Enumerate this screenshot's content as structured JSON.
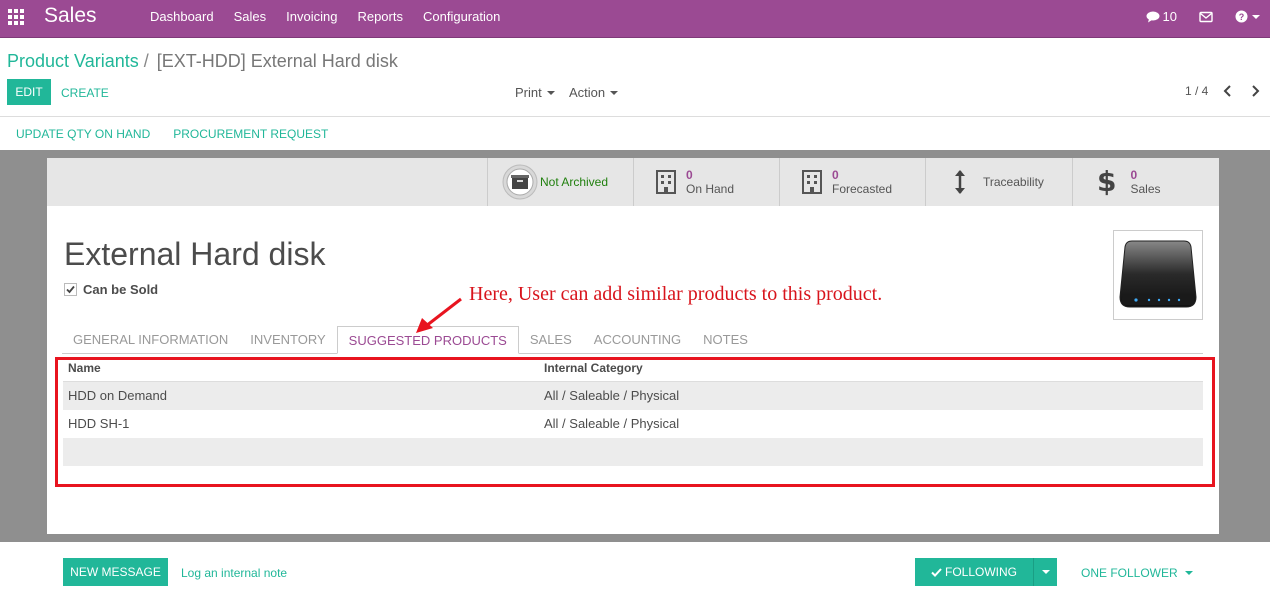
{
  "navbar": {
    "app_name": "Sales",
    "menu": [
      "Dashboard",
      "Sales",
      "Invoicing",
      "Reports",
      "Configuration"
    ],
    "messages_count": "10"
  },
  "breadcrumb": {
    "parent": "Product Variants",
    "separator": "/",
    "current": "[EXT-HDD] External Hard disk"
  },
  "toolbar": {
    "edit_label": "EDIT",
    "create_label": "CREATE",
    "print_label": "Print",
    "action_label": "Action",
    "pager": "1 / 4"
  },
  "header_buttons": [
    "UPDATE QTY ON HAND",
    "PROCUREMENT REQUEST"
  ],
  "smart_buttons": {
    "archive": "Not Archived",
    "on_hand_value": "0",
    "on_hand_label": "On Hand",
    "forecasted_value": "0",
    "forecasted_label": "Forecasted",
    "traceability": "Traceability",
    "sales_value": "0",
    "sales_label": "Sales"
  },
  "product": {
    "name": "External Hard disk",
    "can_be_sold_label": "Can be Sold",
    "can_be_sold": true
  },
  "tabs": [
    "GENERAL INFORMATION",
    "INVENTORY",
    "SUGGESTED PRODUCTS",
    "SALES",
    "ACCOUNTING",
    "NOTES"
  ],
  "active_tab": "SUGGESTED PRODUCTS",
  "table": {
    "headers": [
      "Name",
      "Internal Category"
    ],
    "rows": [
      [
        "HDD on Demand",
        "All / Saleable / Physical"
      ],
      [
        "HDD SH-1",
        "All / Saleable / Physical"
      ]
    ]
  },
  "annotation": "Here, User can add similar products to this product.",
  "chatter": {
    "new_message": "NEW MESSAGE",
    "log_note": "Log an internal note",
    "following": "FOLLOWING",
    "followers": "ONE FOLLOWER"
  },
  "colors": {
    "brand": "#9b4a93",
    "accent": "#21b799",
    "annotation": "#e8141f"
  }
}
